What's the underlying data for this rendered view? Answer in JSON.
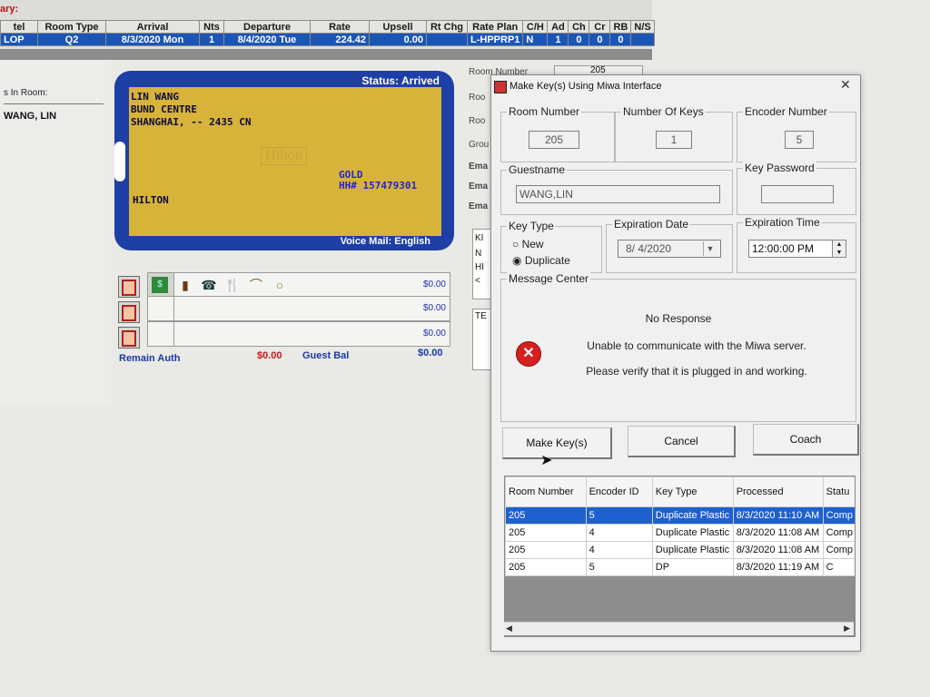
{
  "top": {
    "summary_label": "ary:",
    "headers": [
      "tel",
      "Room Type",
      "Arrival",
      "Nts",
      "Departure",
      "Rate",
      "Upsell",
      "Rt Chg",
      "Rate Plan",
      "C/H",
      "Ad",
      "Ch",
      "Cr",
      "RB",
      "N/S"
    ],
    "row": [
      "LOP",
      "Q2",
      "8/3/2020 Mon",
      "1",
      "8/4/2020 Tue",
      "224.42",
      "0.00",
      "",
      "L-HPPRP1",
      "N",
      "1",
      "0",
      "0",
      "0",
      ""
    ]
  },
  "left": {
    "guests_label": "s In Room:",
    "guest_name": "WANG, LIN"
  },
  "card": {
    "status": "Status: Arrived",
    "line1": "LIN WANG",
    "line2": "BUND CENTRE",
    "line3": "SHANGHAI, --  2435        CN",
    "tier": "GOLD",
    "hhonors": "HH# 157479301",
    "brand": "HILTON",
    "watermark": "Hilton",
    "voicemail": "Voice Mail: English"
  },
  "services": {
    "amounts": [
      "$0.00",
      "$0.00",
      "$0.00"
    ],
    "remain_auth_label": "Remain Auth",
    "remain_auth_value": "$0.00",
    "guest_bal_label": "Guest Bal",
    "guest_bal_value": "$0.00"
  },
  "mid_panel": {
    "room_number_label": "Room Number",
    "room_number_value": "205",
    "labels": [
      "Roo",
      "Roo",
      "Grou",
      "Ema",
      "Ema",
      "Ema"
    ],
    "list_items": [
      "KI",
      "N",
      "HI",
      "<"
    ],
    "text_item": "TE"
  },
  "dialog": {
    "title": "Make Key(s) Using Miwa Interface",
    "room_number_label": "Room Number",
    "room_number": "205",
    "num_keys_label": "Number Of Keys",
    "num_keys": "1",
    "encoder_label": "Encoder Number",
    "encoder": "5",
    "guestname_label": "Guestname",
    "guestname": "WANG,LIN",
    "key_password_label": "Key Password",
    "key_password": "",
    "key_type_label": "Key Type",
    "key_type_new": "New",
    "key_type_duplicate": "Duplicate",
    "expiration_date_label": "Expiration Date",
    "expiration_date": "8/ 4/2020",
    "expiration_time_label": "Expiration Time",
    "expiration_time": "12:00:00 PM",
    "message_center_label": "Message Center",
    "msg1": "No Response",
    "msg2": "Unable to communicate with the Miwa server.",
    "msg3": "Please verify that it is plugged in and working.",
    "make_keys_button": "Make Key(s)",
    "cancel_button": "Cancel",
    "coach_button": "Coach",
    "table_headers": [
      "Room Number",
      "Encoder ID",
      "Key Type",
      "Processed",
      "Statu"
    ],
    "table_rows": [
      [
        "205",
        "5",
        "Duplicate Plastic",
        "8/3/2020 11:10 AM",
        "Comp"
      ],
      [
        "205",
        "4",
        "Duplicate Plastic",
        "8/3/2020 11:08 AM",
        "Comp"
      ],
      [
        "205",
        "4",
        "Duplicate Plastic",
        "8/3/2020 11:08 AM",
        "Comp"
      ],
      [
        "205",
        "5",
        "DP",
        "8/3/2020 11:19 AM",
        "C"
      ]
    ]
  },
  "colors": {
    "selection_blue": "#1a56b8",
    "card_blue": "#1e3fa4",
    "card_gold": "#d8b33a",
    "error_red": "#d62020"
  }
}
